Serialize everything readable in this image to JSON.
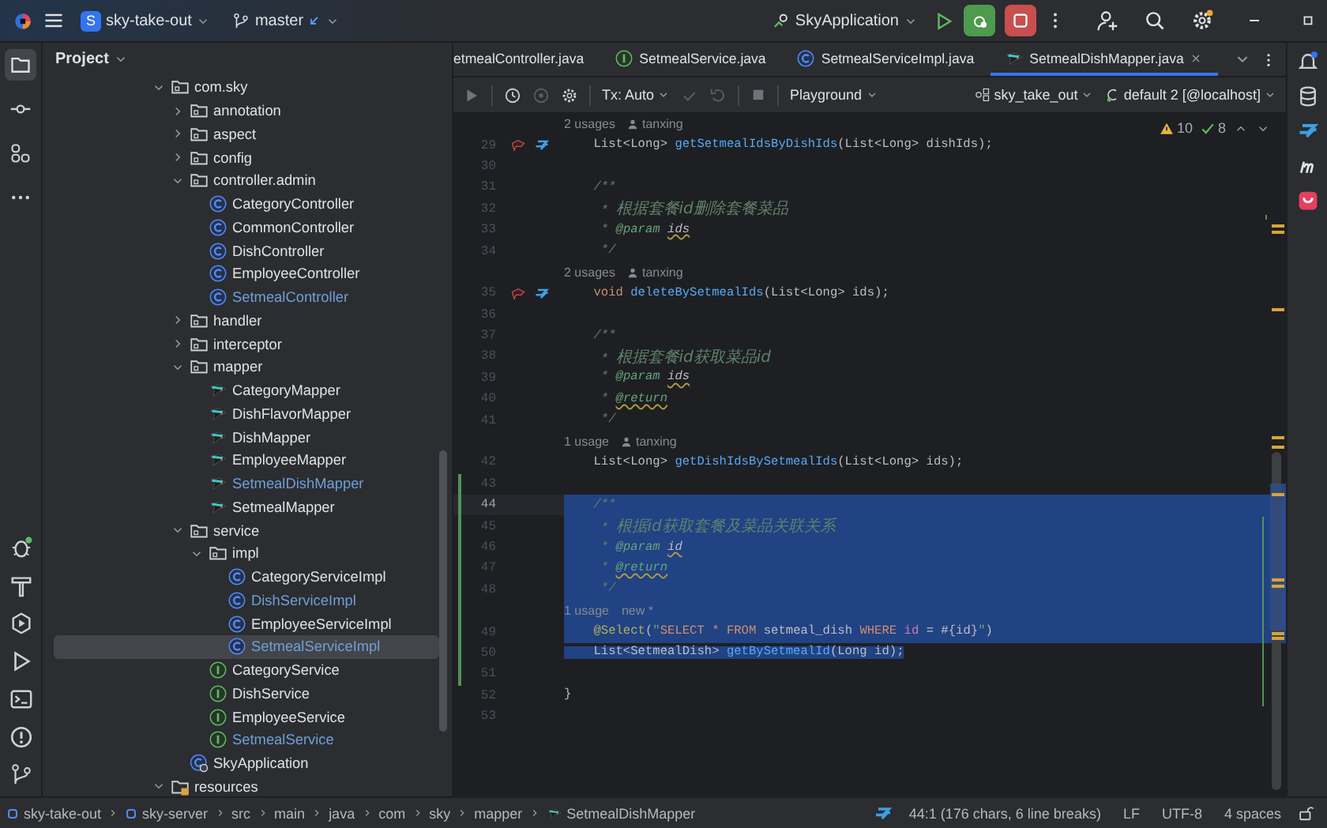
{
  "top_bar": {
    "project_badge": "S",
    "project": "sky-take-out",
    "branch": "master",
    "run_config": "SkyApplication"
  },
  "left_tools": [
    {
      "kind": "folder",
      "selected": true
    },
    {
      "kind": "commit",
      "selected": false
    },
    {
      "kind": "structure",
      "selected": false
    },
    {
      "kind": "more",
      "selected": false
    }
  ],
  "project": {
    "title": "Project",
    "tree": [
      {
        "label": "com.sky",
        "kind": "folder",
        "expanded": true,
        "selected": false,
        "modified": false,
        "children": [
          {
            "label": "annotation",
            "kind": "folder",
            "expanded": false,
            "selected": false,
            "modified": false
          },
          {
            "label": "aspect",
            "kind": "folder",
            "expanded": false,
            "selected": false,
            "modified": false
          },
          {
            "label": "config",
            "kind": "folder",
            "expanded": false,
            "selected": false,
            "modified": false
          },
          {
            "label": "controller.admin",
            "kind": "folder",
            "expanded": true,
            "selected": false,
            "modified": false,
            "children": [
              {
                "label": "CategoryController",
                "kind": "class",
                "selected": false,
                "modified": false
              },
              {
                "label": "CommonController",
                "kind": "class",
                "selected": false,
                "modified": false
              },
              {
                "label": "DishController",
                "kind": "class",
                "selected": false,
                "modified": false
              },
              {
                "label": "EmployeeController",
                "kind": "class",
                "selected": false,
                "modified": false
              },
              {
                "label": "SetmealController",
                "kind": "class",
                "selected": false,
                "modified": true
              }
            ]
          },
          {
            "label": "handler",
            "kind": "folder",
            "expanded": false,
            "selected": false,
            "modified": false
          },
          {
            "label": "interceptor",
            "kind": "folder",
            "expanded": false,
            "selected": false,
            "modified": false
          },
          {
            "label": "mapper",
            "kind": "folder",
            "expanded": true,
            "selected": false,
            "modified": false,
            "children": [
              {
                "label": "CategoryMapper",
                "kind": "mapper",
                "selected": false,
                "modified": false
              },
              {
                "label": "DishFlavorMapper",
                "kind": "mapper",
                "selected": false,
                "modified": false
              },
              {
                "label": "DishMapper",
                "kind": "mapper",
                "selected": false,
                "modified": false
              },
              {
                "label": "EmployeeMapper",
                "kind": "mapper",
                "selected": false,
                "modified": false
              },
              {
                "label": "SetmealDishMapper",
                "kind": "mapper",
                "selected": false,
                "modified": true
              },
              {
                "label": "SetmealMapper",
                "kind": "mapper",
                "selected": false,
                "modified": false
              }
            ]
          },
          {
            "label": "service",
            "kind": "folder",
            "expanded": true,
            "selected": false,
            "modified": false,
            "children": [
              {
                "label": "impl",
                "kind": "folder",
                "expanded": true,
                "selected": false,
                "modified": false,
                "children": [
                  {
                    "label": "CategoryServiceImpl",
                    "kind": "class",
                    "selected": false,
                    "modified": false
                  },
                  {
                    "label": "DishServiceImpl",
                    "kind": "class",
                    "selected": false,
                    "modified": true
                  },
                  {
                    "label": "EmployeeServiceImpl",
                    "kind": "class",
                    "selected": false,
                    "modified": false
                  },
                  {
                    "label": "SetmealServiceImpl",
                    "kind": "class",
                    "selected": true,
                    "modified": true
                  }
                ]
              },
              {
                "label": "CategoryService",
                "kind": "interface",
                "selected": false,
                "modified": false
              },
              {
                "label": "DishService",
                "kind": "interface",
                "selected": false,
                "modified": false
              },
              {
                "label": "EmployeeService",
                "kind": "interface",
                "selected": false,
                "modified": false
              },
              {
                "label": "SetmealService",
                "kind": "interface",
                "selected": false,
                "modified": true
              }
            ]
          },
          {
            "label": "SkyApplication",
            "kind": "app",
            "selected": false,
            "modified": false
          }
        ]
      },
      {
        "label": "resources",
        "kind": "resources",
        "expanded": true,
        "selected": false,
        "modified": false
      }
    ]
  },
  "tabs": [
    {
      "label": "etmealController.java",
      "kind": "text",
      "selected": false
    },
    {
      "label": "SetmealService.java",
      "kind": "interface",
      "selected": false
    },
    {
      "label": "SetmealServiceImpl.java",
      "kind": "class",
      "selected": false
    },
    {
      "label": "SetmealDishMapper.java",
      "kind": "mapper",
      "selected": true
    }
  ],
  "editor_toolbar": {
    "tx": "Tx: Auto",
    "playground": "Playground",
    "datasource": "sky_take_out",
    "session": "default 2 [@localhost]"
  },
  "inspections": {
    "warnings": "10",
    "checks": "8"
  },
  "code": [
    {
      "kind": "hint",
      "usages": "2 usages",
      "author": "tanxing",
      "selected": false,
      "changed": false,
      "current": false
    },
    {
      "kind": "code",
      "number": "29",
      "selected": false,
      "changed": false,
      "current": false,
      "markers": true,
      "tokens": [
        {
          "kind": "plain",
          "text": "    List<Long> "
        },
        {
          "kind": "method",
          "text": "getSetmealIdsByDishIds"
        },
        {
          "kind": "plain",
          "text": "(List<Long> dishIds);"
        }
      ]
    },
    {
      "kind": "code",
      "number": "30",
      "selected": false,
      "changed": false,
      "current": false,
      "markers": false
    },
    {
      "kind": "code",
      "number": "31",
      "selected": false,
      "changed": false,
      "current": false,
      "markers": false,
      "tokens": [
        {
          "kind": "doc",
          "text": "    /**"
        }
      ]
    },
    {
      "kind": "code",
      "number": "32",
      "selected": false,
      "changed": false,
      "current": false,
      "markers": false,
      "tokens": [
        {
          "kind": "doc",
          "text": "     * "
        },
        {
          "kind": "doc-text",
          "text": "根据套餐id删除套餐菜品"
        }
      ]
    },
    {
      "kind": "code",
      "number": "33",
      "selected": false,
      "changed": false,
      "current": false,
      "markers": false,
      "tokens": [
        {
          "kind": "doc",
          "text": "     * "
        },
        {
          "kind": "doc-tag",
          "text": "@param "
        },
        {
          "kind": "doc-ref",
          "text": "ids"
        }
      ]
    },
    {
      "kind": "code",
      "number": "34",
      "selected": false,
      "changed": false,
      "current": false,
      "markers": false,
      "tokens": [
        {
          "kind": "doc",
          "text": "     */"
        }
      ]
    },
    {
      "kind": "hint",
      "usages": "2 usages",
      "author": "tanxing",
      "selected": false,
      "changed": false,
      "current": false
    },
    {
      "kind": "code",
      "number": "35",
      "selected": false,
      "changed": false,
      "current": false,
      "markers": true,
      "tokens": [
        {
          "kind": "keyword",
          "text": "    void "
        },
        {
          "kind": "method",
          "text": "deleteBySetmealIds"
        },
        {
          "kind": "plain",
          "text": "(List<Long> ids);"
        }
      ]
    },
    {
      "kind": "code",
      "number": "36",
      "selected": false,
      "changed": false,
      "current": false,
      "markers": false
    },
    {
      "kind": "code",
      "number": "37",
      "selected": false,
      "changed": false,
      "current": false,
      "markers": false,
      "tokens": [
        {
          "kind": "doc",
          "text": "    /**"
        }
      ]
    },
    {
      "kind": "code",
      "number": "38",
      "selected": false,
      "changed": false,
      "current": false,
      "markers": false,
      "tokens": [
        {
          "kind": "doc",
          "text": "     * "
        },
        {
          "kind": "doc-text",
          "text": "根据套餐id获取菜品id"
        }
      ]
    },
    {
      "kind": "code",
      "number": "39",
      "selected": false,
      "changed": false,
      "current": false,
      "markers": false,
      "tokens": [
        {
          "kind": "doc",
          "text": "     * "
        },
        {
          "kind": "doc-tag",
          "text": "@param "
        },
        {
          "kind": "doc-ref",
          "text": "ids"
        }
      ]
    },
    {
      "kind": "code",
      "number": "40",
      "selected": false,
      "changed": false,
      "current": false,
      "markers": false,
      "tokens": [
        {
          "kind": "doc",
          "text": "     * "
        },
        {
          "kind": "doc-tag-warn",
          "text": "@return"
        }
      ]
    },
    {
      "kind": "code",
      "number": "41",
      "selected": false,
      "changed": false,
      "current": false,
      "markers": false,
      "tokens": [
        {
          "kind": "doc",
          "text": "     */"
        }
      ]
    },
    {
      "kind": "hint",
      "usages": "1 usage",
      "author": "tanxing",
      "selected": false,
      "changed": false,
      "current": false
    },
    {
      "kind": "code",
      "number": "42",
      "selected": false,
      "changed": false,
      "current": false,
      "markers": false,
      "tokens": [
        {
          "kind": "plain",
          "text": "    List<Long> "
        },
        {
          "kind": "method",
          "text": "getDishIdsBySetmealIds"
        },
        {
          "kind": "plain",
          "text": "(List<Long> ids);"
        }
      ]
    },
    {
      "kind": "code",
      "number": "43",
      "selected": false,
      "changed": true,
      "current": false,
      "markers": false
    },
    {
      "kind": "code",
      "number": "44",
      "selected": true,
      "changed": true,
      "current": true,
      "markers": false,
      "tokens": [
        {
          "kind": "doc",
          "text": "    /**"
        }
      ]
    },
    {
      "kind": "code",
      "number": "45",
      "selected": true,
      "changed": true,
      "current": false,
      "markers": false,
      "tokens": [
        {
          "kind": "doc",
          "text": "     * "
        },
        {
          "kind": "doc-text",
          "text": "根据id获取套餐及菜品关联关系"
        }
      ]
    },
    {
      "kind": "code",
      "number": "46",
      "selected": true,
      "changed": true,
      "current": false,
      "markers": false,
      "tokens": [
        {
          "kind": "doc",
          "text": "     * "
        },
        {
          "kind": "doc-tag",
          "text": "@param "
        },
        {
          "kind": "doc-ref",
          "text": "id"
        }
      ]
    },
    {
      "kind": "code",
      "number": "47",
      "selected": true,
      "changed": true,
      "current": false,
      "markers": false,
      "tokens": [
        {
          "kind": "doc",
          "text": "     * "
        },
        {
          "kind": "doc-tag-warn",
          "text": "@return"
        }
      ]
    },
    {
      "kind": "code",
      "number": "48",
      "selected": true,
      "changed": true,
      "current": false,
      "markers": false,
      "tokens": [
        {
          "kind": "doc",
          "text": "     */"
        }
      ]
    },
    {
      "kind": "hint",
      "usages": "1 usage",
      "note": "new *",
      "selected": true,
      "changed": true,
      "current": false
    },
    {
      "kind": "code",
      "number": "49",
      "selected": true,
      "changed": true,
      "current": false,
      "markers": false,
      "tokens": [
        {
          "kind": "annotation",
          "text": "    @Select"
        },
        {
          "kind": "plain",
          "text": "("
        },
        {
          "kind": "string",
          "text": "\""
        },
        {
          "kind": "sql-keyword",
          "text": "SELECT * FROM "
        },
        {
          "kind": "plain",
          "text": "setmeal_dish "
        },
        {
          "kind": "sql-keyword",
          "text": "WHERE "
        },
        {
          "kind": "sql-column",
          "text": "id "
        },
        {
          "kind": "plain",
          "text": "= #{id}"
        },
        {
          "kind": "string",
          "text": "\""
        },
        {
          "kind": "plain",
          "text": ")"
        }
      ]
    },
    {
      "kind": "code",
      "number": "50",
      "selected": true,
      "selection_ends_at_text": true,
      "changed": true,
      "current": false,
      "markers": false,
      "tokens": [
        {
          "kind": "plain",
          "text": "    List<SetmealDish> "
        },
        {
          "kind": "method",
          "text": "getBySetmealId"
        },
        {
          "kind": "plain",
          "text": "(Long id);"
        }
      ]
    },
    {
      "kind": "code",
      "number": "51",
      "selected": false,
      "changed": true,
      "current": false,
      "markers": false
    },
    {
      "kind": "code",
      "number": "52",
      "selected": false,
      "changed": false,
      "current": false,
      "markers": false,
      "tokens": [
        {
          "kind": "plain",
          "text": "}"
        }
      ]
    },
    {
      "kind": "code",
      "number": "53",
      "selected": false,
      "changed": false,
      "current": false,
      "markers": false
    }
  ],
  "status_bar": {
    "breadcrumbs": [
      "sky-take-out",
      "sky-server",
      "src",
      "main",
      "java",
      "com",
      "sky",
      "mapper",
      "SetmealDishMapper"
    ],
    "position": "44:1 (176 chars, 6 line breaks)",
    "line_separator": "LF",
    "encoding": "UTF-8",
    "indent": "4 spaces"
  }
}
